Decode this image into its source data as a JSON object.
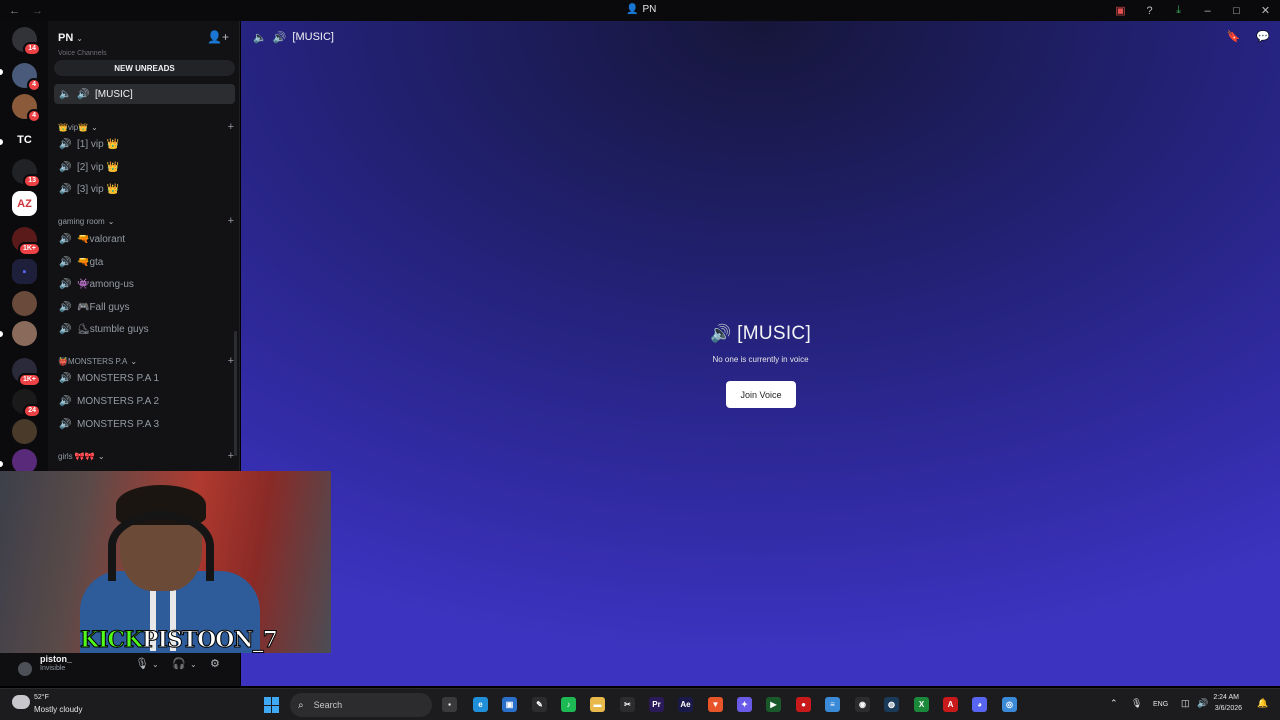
{
  "window": {
    "title": "PN",
    "title_icon": "user-icon",
    "nav_back": "←",
    "nav_forward": "→",
    "right_icons": [
      "inbox-icon",
      "help-icon",
      "download-icon",
      "minimize-icon",
      "maximize-icon",
      "close-icon"
    ]
  },
  "servers": [
    {
      "label": "",
      "badge": "14",
      "icon": "discord-home-icon",
      "color": "#313338"
    },
    {
      "label": "",
      "badge": "4",
      "icon": "server-avatar",
      "color": "#4a5a7a"
    },
    {
      "label": "",
      "badge": "4",
      "icon": "server-avatar",
      "color": "#8a5a3a"
    },
    {
      "label": "TC",
      "badge": "",
      "icon": "",
      "color": "#0b0b0d"
    },
    {
      "label": "",
      "badge": "13",
      "icon": "server-avatar",
      "color": "#202226"
    },
    {
      "label": "AZ",
      "badge": "",
      "icon": "",
      "color": "#ffffff"
    },
    {
      "label": "",
      "badge": "1K+",
      "icon": "server-avatar",
      "color": "#5a1a1a"
    },
    {
      "label": "",
      "badge": "",
      "icon": "folder-icon",
      "color": "#1e1f3a"
    },
    {
      "label": "",
      "badge": "",
      "icon": "server-avatar",
      "color": "#6a4a3a"
    },
    {
      "label": "",
      "badge": "",
      "icon": "server-avatar",
      "color": "#8a6a5a"
    },
    {
      "label": "",
      "badge": "1K+",
      "icon": "server-avatar",
      "color": "#2a2a3a"
    },
    {
      "label": "",
      "badge": "24",
      "icon": "server-avatar",
      "color": "#1a1a1a"
    },
    {
      "label": "",
      "badge": "",
      "icon": "server-avatar",
      "color": "#4a3a2a"
    },
    {
      "label": "",
      "badge": "",
      "icon": "server-avatar",
      "color": "#5a2a7a"
    }
  ],
  "sidebar": {
    "server_name": "PN",
    "partial_category": "Voice Channels",
    "new_unreads": "NEW UNREADS",
    "selected_channel": "[MUSIC]",
    "categories": [
      {
        "name": "👑vip👑",
        "channels": [
          "[1] vip 👑",
          "[2] vip 👑",
          "[3] vip 👑"
        ]
      },
      {
        "name": "gaming room",
        "channels": [
          "🔫valorant",
          "🔫gta",
          "👾among-us",
          "🎮Fall guys",
          "⛸stumble guys"
        ]
      },
      {
        "name": "👹MONSTERS P.A",
        "channels": [
          "MONSTERS P.A 1",
          "MONSTERS P.A 2",
          "MONSTERS P.A 3"
        ]
      },
      {
        "name": "girls 🎀🎀",
        "channels": []
      }
    ]
  },
  "user_panel": {
    "name": "piston_",
    "status": "Invisible",
    "icons": [
      "microphone-icon",
      "headphones-icon",
      "settings-icon"
    ]
  },
  "main": {
    "header_title": "[MUSIC]",
    "voice_name": "[MUSIC]",
    "voice_subtitle": "No one is currently in voice",
    "join_button": "Join Voice",
    "right_icons": [
      "bookmark-icon",
      "chat-icon"
    ]
  },
  "webcam": {
    "caption_kick": "KICK",
    "caption_name": "PISTOON_7"
  },
  "taskbar": {
    "weather_temp": "52°F",
    "weather_desc": "Mostly cloudy",
    "search_label": "Search",
    "apps": [
      {
        "icon": "file-explorer-icon",
        "color": "#3a3a3d",
        "glyph": "▪"
      },
      {
        "icon": "edge-icon",
        "color": "#1e8fd8",
        "glyph": "e"
      },
      {
        "icon": "store-icon",
        "color": "#2a6fc9",
        "glyph": "▣"
      },
      {
        "icon": "pen-icon",
        "color": "#2c2c2f",
        "glyph": "✎"
      },
      {
        "icon": "spotify-icon",
        "color": "#1db954",
        "glyph": "♪"
      },
      {
        "icon": "folder-icon",
        "color": "#e8b84a",
        "glyph": "▬"
      },
      {
        "icon": "capcut-icon",
        "color": "#2c2c2f",
        "glyph": "✂"
      },
      {
        "icon": "premiere-icon",
        "color": "#2a1a5a",
        "glyph": "Pr"
      },
      {
        "icon": "after-effects-icon",
        "color": "#1a1a4a",
        "glyph": "Ae"
      },
      {
        "icon": "brave-icon",
        "color": "#e8552a",
        "glyph": "▼"
      },
      {
        "icon": "copilot-icon",
        "color": "#6a5ae8",
        "glyph": "✦"
      },
      {
        "icon": "terminal-icon",
        "color": "#1a5a2a",
        "glyph": "▶"
      },
      {
        "icon": "record-icon",
        "color": "#c81a1a",
        "glyph": "●"
      },
      {
        "icon": "notepad-icon",
        "color": "#3a8ad8",
        "glyph": "≡"
      },
      {
        "icon": "obs-icon",
        "color": "#2c2c2f",
        "glyph": "◉"
      },
      {
        "icon": "steam-icon",
        "color": "#1a3a5a",
        "glyph": "◍"
      },
      {
        "icon": "xbox-icon",
        "color": "#1a8a3a",
        "glyph": "X"
      },
      {
        "icon": "acrobat-icon",
        "color": "#c81a1a",
        "glyph": "A"
      },
      {
        "icon": "discord-icon",
        "color": "#5865f2",
        "glyph": "◕"
      },
      {
        "icon": "chrome-icon",
        "color": "#3a8ad8",
        "glyph": "◎"
      }
    ],
    "language": "ENG",
    "time": "2:24 AM",
    "date": "3/6/2026"
  }
}
